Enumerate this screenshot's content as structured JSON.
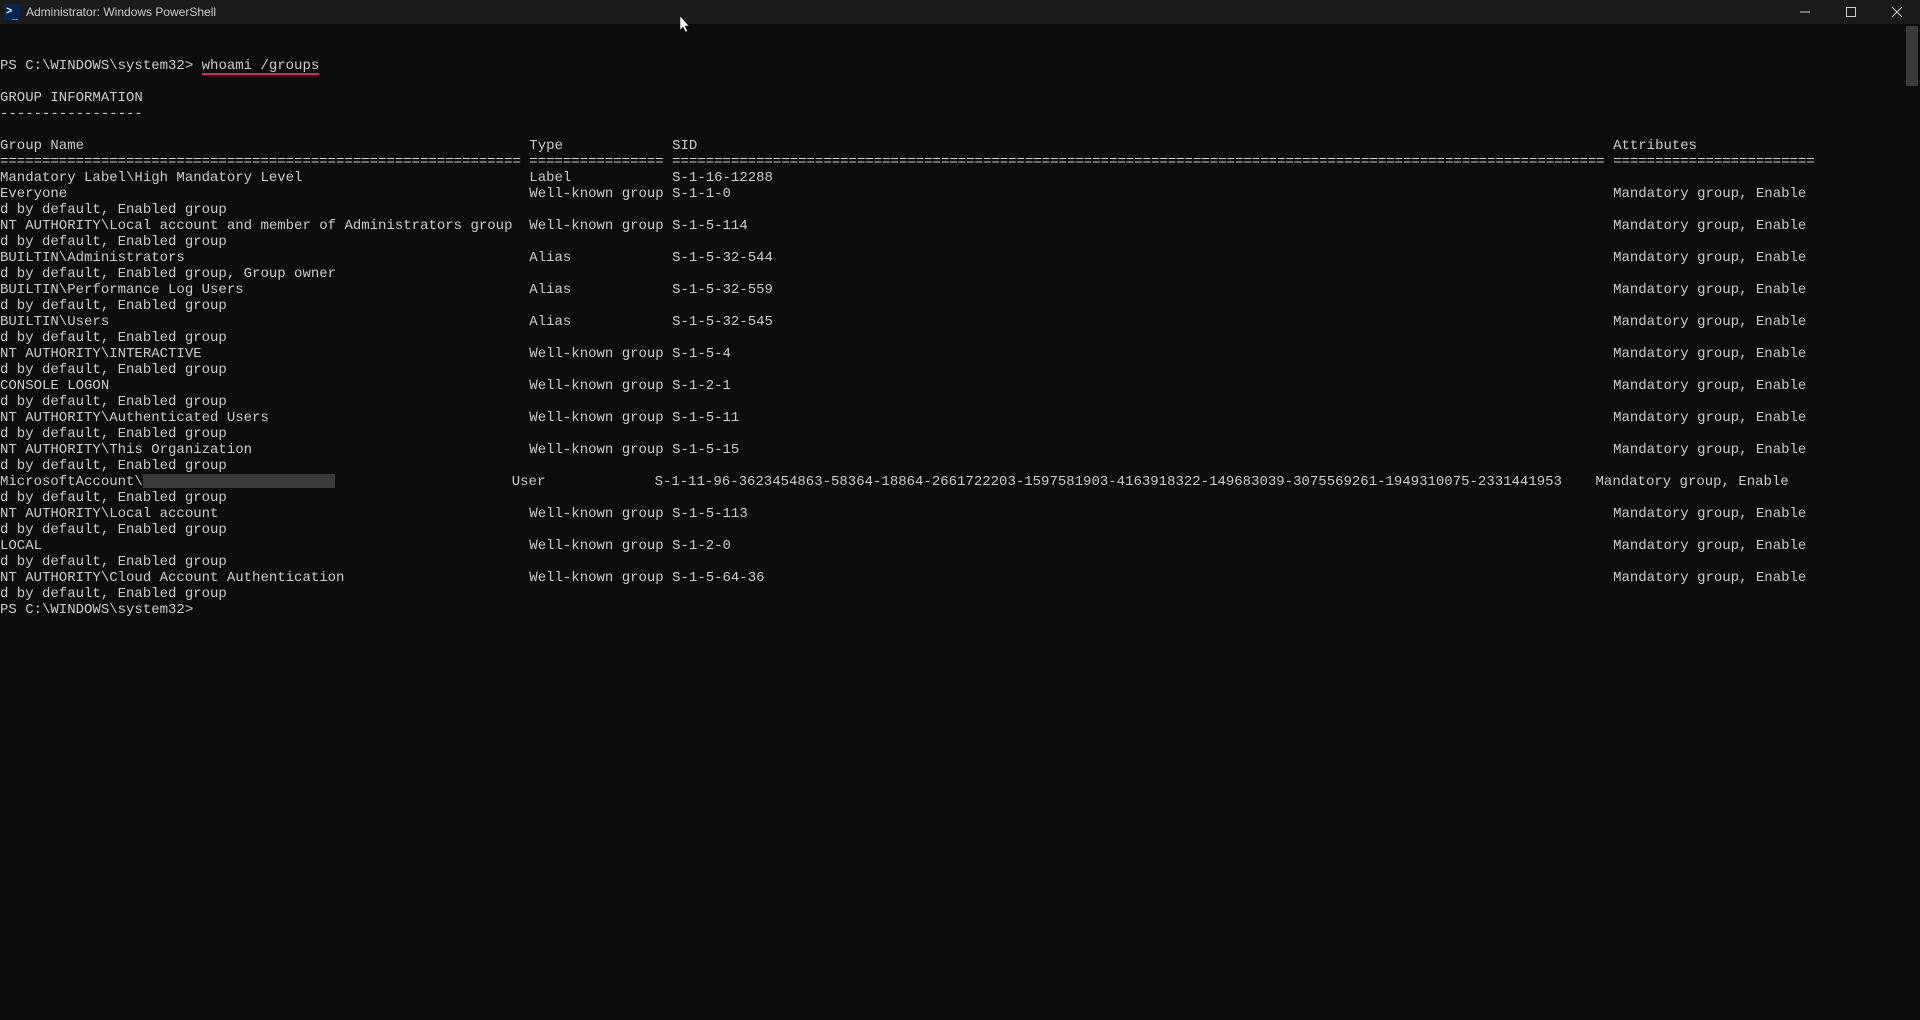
{
  "window": {
    "title": "Administrator: Windows PowerShell"
  },
  "terminal": {
    "prompt_prefix": "PS C:\\WINDOWS\\system32> ",
    "command": "whoami /groups",
    "section_title": "GROUP INFORMATION",
    "section_underline": "-----------------",
    "headers": {
      "group_name": "Group Name",
      "type": "Type",
      "sid": "SID",
      "attributes": "Attributes"
    },
    "rule_segments": {
      "c1": "===============================================================",
      "c2": "================",
      "c3": "================================================================================================================",
      "c4": "========================",
      "c5": "================================================="
    },
    "rows": [
      {
        "name": "Mandatory Label\\High Mandatory Level",
        "type": "Label",
        "sid": "S-1-16-12288",
        "attr": "",
        "wrap": ""
      },
      {
        "name": "Everyone",
        "type": "Well-known group",
        "sid": "S-1-1-0",
        "attr": "Mandatory group, Enable",
        "wrap": "d by default, Enabled group"
      },
      {
        "name": "NT AUTHORITY\\Local account and member of Administrators group",
        "type": "Well-known group",
        "sid": "S-1-5-114",
        "attr": "Mandatory group, Enable",
        "wrap": "d by default, Enabled group"
      },
      {
        "name": "BUILTIN\\Administrators",
        "type": "Alias",
        "sid": "S-1-5-32-544",
        "attr": "Mandatory group, Enable",
        "wrap": "d by default, Enabled group, Group owner"
      },
      {
        "name": "BUILTIN\\Performance Log Users",
        "type": "Alias",
        "sid": "S-1-5-32-559",
        "attr": "Mandatory group, Enable",
        "wrap": "d by default, Enabled group"
      },
      {
        "name": "BUILTIN\\Users",
        "type": "Alias",
        "sid": "S-1-5-32-545",
        "attr": "Mandatory group, Enable",
        "wrap": "d by default, Enabled group"
      },
      {
        "name": "NT AUTHORITY\\INTERACTIVE",
        "type": "Well-known group",
        "sid": "S-1-5-4",
        "attr": "Mandatory group, Enable",
        "wrap": "d by default, Enabled group"
      },
      {
        "name": "CONSOLE LOGON",
        "type": "Well-known group",
        "sid": "S-1-2-1",
        "attr": "Mandatory group, Enable",
        "wrap": "d by default, Enabled group"
      },
      {
        "name": "NT AUTHORITY\\Authenticated Users",
        "type": "Well-known group",
        "sid": "S-1-5-11",
        "attr": "Mandatory group, Enable",
        "wrap": "d by default, Enabled group"
      },
      {
        "name": "NT AUTHORITY\\This Organization",
        "type": "Well-known group",
        "sid": "S-1-5-15",
        "attr": "Mandatory group, Enable",
        "wrap": "d by default, Enabled group"
      },
      {
        "name": "MicrosoftAccount\\",
        "redacted": true,
        "type": "User",
        "sid": "S-1-11-96-3623454863-58364-18864-2661722203-1597581903-4163918322-149683039-3075569261-1949310075-2331441953",
        "attr": "Mandatory group, Enable",
        "wrap": "d by default, Enabled group"
      },
      {
        "name": "NT AUTHORITY\\Local account",
        "type": "Well-known group",
        "sid": "S-1-5-113",
        "attr": "Mandatory group, Enable",
        "wrap": "d by default, Enabled group"
      },
      {
        "name": "LOCAL",
        "type": "Well-known group",
        "sid": "S-1-2-0",
        "attr": "Mandatory group, Enable",
        "wrap": "d by default, Enabled group"
      },
      {
        "name": "NT AUTHORITY\\Cloud Account Authentication",
        "type": "Well-known group",
        "sid": "S-1-5-64-36",
        "attr": "Mandatory group, Enable",
        "wrap": "d by default, Enabled group"
      }
    ],
    "final_prompt": "PS C:\\WINDOWS\\system32>"
  },
  "columns": {
    "name_w": 63,
    "type_w": 17,
    "sid_w": 112
  }
}
